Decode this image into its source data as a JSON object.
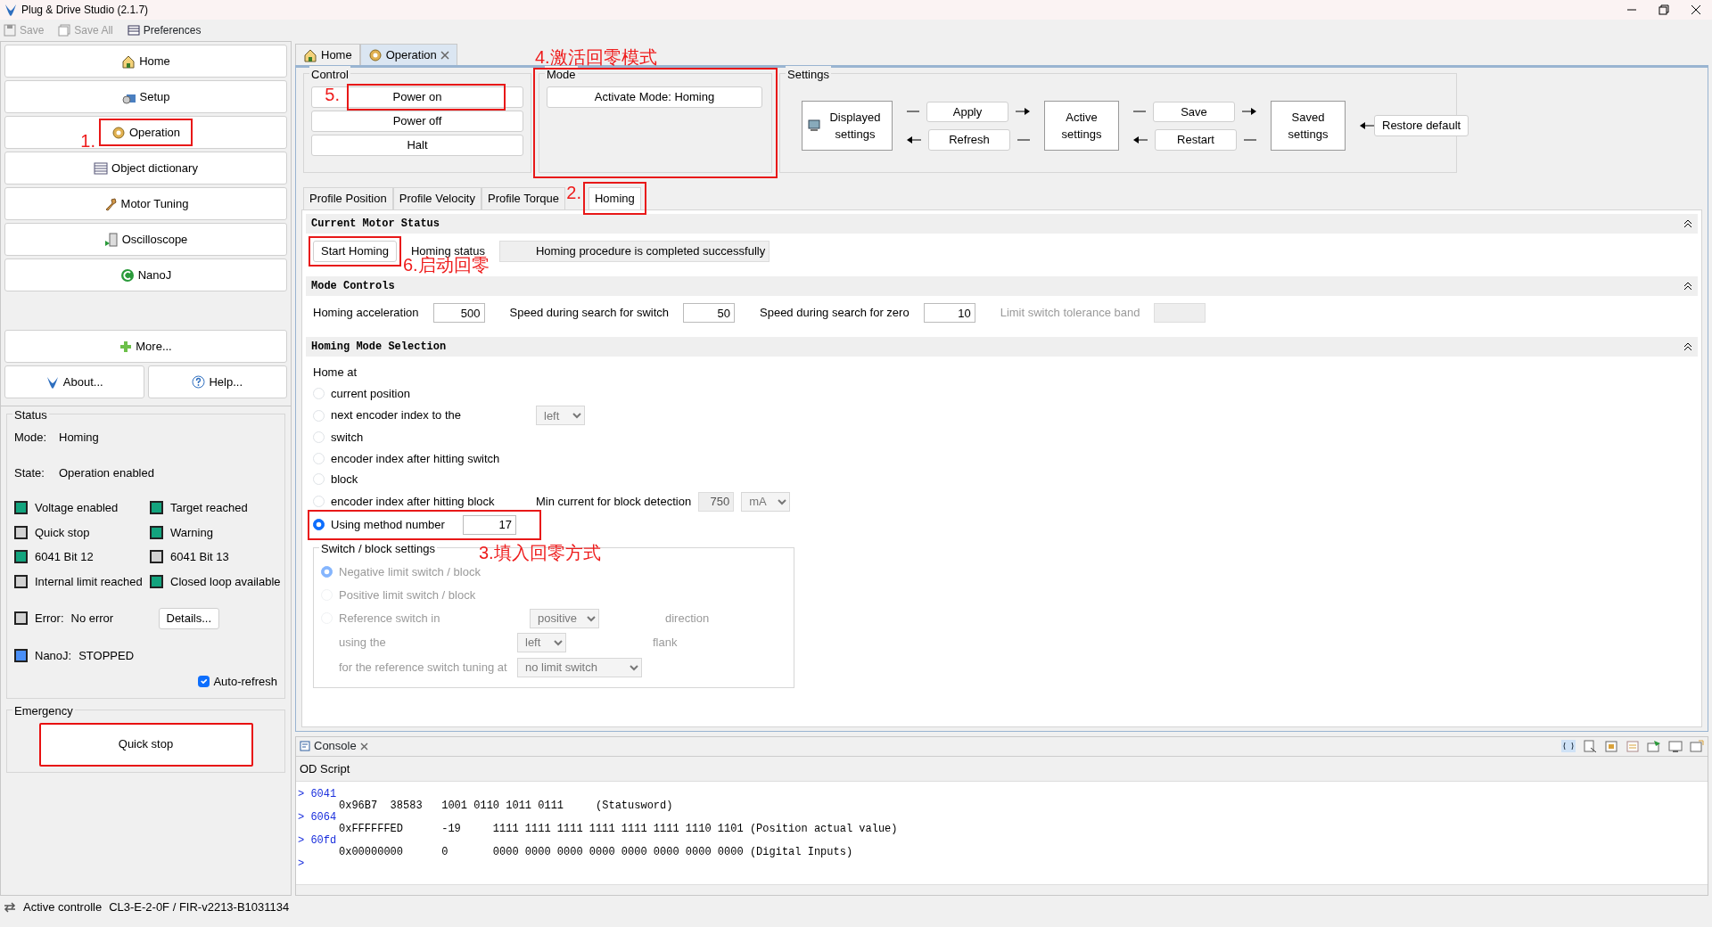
{
  "window": {
    "title": "Plug & Drive Studio (2.1.7)"
  },
  "toolbar": [
    {
      "label": "Save",
      "disabled": true
    },
    {
      "label": "Save All",
      "disabled": true
    },
    {
      "label": "Preferences",
      "disabled": false
    }
  ],
  "nav": {
    "items": [
      {
        "label": "Home"
      },
      {
        "label": "Setup"
      },
      {
        "label": "Operation",
        "annotation": "1."
      },
      {
        "label": "Object dictionary"
      },
      {
        "label": "Motor Tuning"
      },
      {
        "label": "Oscilloscope"
      },
      {
        "label": "NanoJ"
      }
    ],
    "more": "More...",
    "about": "About...",
    "help": "Help..."
  },
  "status": {
    "title": "Status",
    "mode_label": "Mode:",
    "mode": "Homing",
    "state_label": "State:",
    "state": "Operation enabled",
    "flags": [
      {
        "label": "Voltage enabled",
        "on": true
      },
      {
        "label": "Target reached",
        "on": true
      },
      {
        "label": "Quick stop",
        "on": false
      },
      {
        "label": "Warning",
        "on": true
      },
      {
        "label": "6041 Bit 12",
        "on": true
      },
      {
        "label": "6041 Bit 13",
        "on": false
      },
      {
        "label": "Internal limit reached",
        "on": false
      },
      {
        "label": "Closed loop available",
        "on": true
      }
    ],
    "error": {
      "label": "Error:",
      "value": "No error",
      "on": false,
      "button": "Details..."
    },
    "nanoj": {
      "label": "NanoJ:",
      "value": "STOPPED",
      "on": true
    },
    "auto_refresh": {
      "label": "Auto-refresh",
      "checked": true
    }
  },
  "emergency": {
    "title": "Emergency",
    "button": "Quick stop"
  },
  "editor_tabs": [
    {
      "label": "Home",
      "selected": false,
      "closable": false
    },
    {
      "label": "Operation",
      "selected": true,
      "closable": true
    }
  ],
  "control": {
    "title": "Control",
    "buttons": [
      {
        "label": "Power on",
        "annotation": "5."
      },
      {
        "label": "Power off"
      },
      {
        "label": "Halt"
      }
    ]
  },
  "mode": {
    "title": "Mode",
    "button": "Activate Mode: Homing",
    "annotation": "4.激活回零模式"
  },
  "settings": {
    "title": "Settings",
    "displayed": "Displayed settings",
    "active": "Active settings",
    "saved": "Saved settings",
    "apply": "Apply",
    "refresh": "Refresh",
    "save": "Save",
    "restart": "Restart",
    "restore": "Restore default"
  },
  "mode_tabs": [
    {
      "label": "Profile Position",
      "selected": false
    },
    {
      "label": "Profile Velocity",
      "selected": false
    },
    {
      "label": "Profile Torque",
      "selected": false
    },
    {
      "label": "Homing",
      "selected": true,
      "annotation": "2."
    }
  ],
  "current_status": {
    "title": "Current Motor Status",
    "start_button": "Start Homing",
    "annotation": "6.启动回零",
    "status_label": "Homing status",
    "status_value": "Homing procedure is completed successfully"
  },
  "mode_controls": {
    "title": "Mode Controls",
    "fields": [
      {
        "label": "Homing acceleration",
        "value": "500",
        "disabled": false
      },
      {
        "label": "Speed during search for switch",
        "value": "50",
        "disabled": false
      },
      {
        "label": "Speed during search for zero",
        "value": "10",
        "disabled": false
      },
      {
        "label": "Limit switch tolerance band",
        "disabled": true
      }
    ]
  },
  "homing_selection": {
    "title": "Homing Mode Selection",
    "home_at": "Home at",
    "options": [
      {
        "label": "current position",
        "selected": false
      },
      {
        "label": "next encoder index to the",
        "selected": false,
        "select": "left"
      },
      {
        "label": "switch",
        "selected": false
      },
      {
        "label": "encoder index after hitting switch",
        "selected": false
      },
      {
        "label": "block",
        "selected": false
      },
      {
        "label": "encoder index after hitting block",
        "selected": false,
        "extra": {
          "label": "Min current for block detection",
          "value": "750",
          "unit": "mA"
        }
      },
      {
        "label": "Using method number",
        "selected": true,
        "value": "17",
        "annotation": "3.填入回零方式"
      }
    ],
    "switch_block": {
      "title": "Switch / block settings",
      "disabled": true,
      "options": [
        {
          "label": "Negative limit switch / block",
          "selected": true
        },
        {
          "label": "Positive limit switch / block",
          "selected": false
        },
        {
          "label": "Reference switch in",
          "selected": false,
          "select": "positive",
          "suffix": "direction"
        }
      ],
      "rows": [
        {
          "label": "using the",
          "select": "left",
          "suffix": "flank"
        },
        {
          "label": "for the reference switch tuning at",
          "select": "no limit switch"
        }
      ]
    }
  },
  "console": {
    "title": "Console",
    "subtitle": "OD Script",
    "lines": [
      {
        "kind": "prompt",
        "text": "> 6041"
      },
      {
        "kind": "output",
        "text": "0x96B7  38583   1001 0110 1011 0111     (Statusword)"
      },
      {
        "kind": "prompt",
        "text": "> 6064"
      },
      {
        "kind": "output",
        "text": "0xFFFFFFED      -19     1111 1111 1111 1111 1111 1111 1110 1101 (Position actual value)"
      },
      {
        "kind": "prompt",
        "text": "> 60fd"
      },
      {
        "kind": "output",
        "text": "0x00000000      0       0000 0000 0000 0000 0000 0000 0000 0000 (Digital Inputs)"
      },
      {
        "kind": "prompt",
        "text": ">"
      }
    ]
  },
  "status_bar": {
    "label": "Active controlle",
    "value": "CL3-E-2-0F / FIR-v2213-B1031134"
  }
}
